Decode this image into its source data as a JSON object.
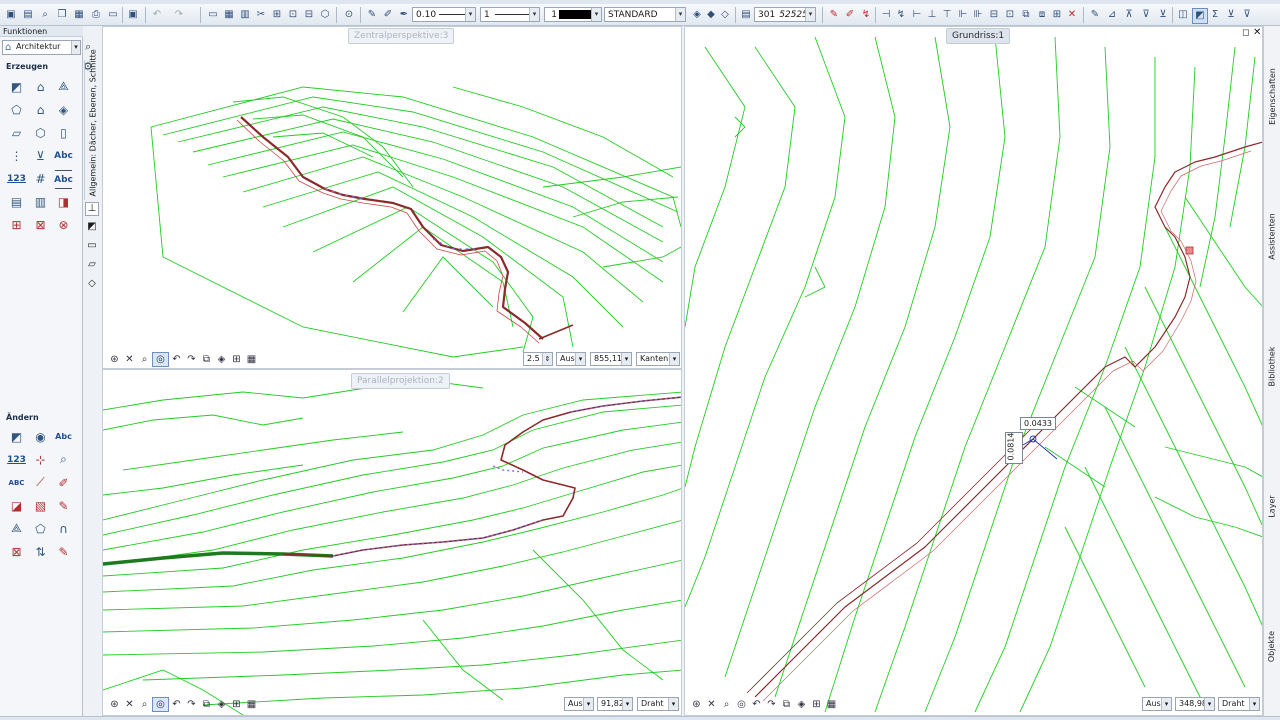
{
  "toolbar": {
    "pen_value": "0.10",
    "line_value": "1",
    "color_value": "1",
    "style_value": "STANDARD",
    "layer_value": "301",
    "layer_name": "52525"
  },
  "palette": {
    "title": "Funktionen",
    "module": "Architektur",
    "section_create": "Erzeugen",
    "section_modify": "Ändern",
    "vertical_tab": "Allgemein: Dächer, Ebenen, Schnitte",
    "text_abc": "Abc",
    "text_123": "123",
    "text_abc_small": "ABC"
  },
  "viewports": {
    "top_left": {
      "title": "Zentralperspektive:3",
      "scale": "2.5",
      "mode": "Aus",
      "value": "855,11",
      "display": "Kanten"
    },
    "bottom_left": {
      "title": "Parallelprojektion:2",
      "mode": "Aus",
      "value": "91,82",
      "display": "Draht"
    },
    "right": {
      "title": "Grundriss:1",
      "mode": "Aus",
      "value": "348,98",
      "display": "Draht",
      "measure_x": "0.0433",
      "measure_y": "0.0814"
    }
  },
  "right_tabs": [
    "Eigenschaften",
    "Assistenten",
    "Bibliothek",
    "Layer",
    "Objekte"
  ],
  "colors": {
    "contour": "#22cc22",
    "path": "#8a2a2a",
    "path_accent": "#7b6fe0"
  }
}
